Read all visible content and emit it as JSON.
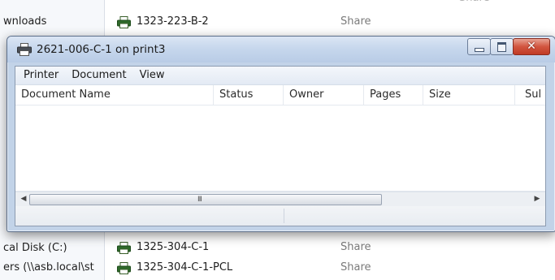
{
  "background_explorer": {
    "sidebar_items": [
      {
        "label": "wnloads"
      },
      {
        "label": "cal Disk (C:)"
      },
      {
        "label": "ers (\\\\asb.local\\st"
      }
    ],
    "printers": [
      {
        "name": "1323-223-B-2",
        "share": "Share"
      },
      {
        "name": "1325-304-C-1",
        "share": "Share"
      },
      {
        "name": "1325-304-C-1-PCL",
        "share": "Share"
      }
    ],
    "top_partial_share": "Share"
  },
  "dialog": {
    "title": "2621-006-C-1 on print3",
    "menu": [
      "Printer",
      "Document",
      "View"
    ],
    "columns": [
      "Document Name",
      "Status",
      "Owner",
      "Pages",
      "Size",
      "Sul"
    ],
    "rows": [],
    "scrollbar_grip": "III"
  },
  "colors": {
    "title_gradient_top": "#dbe6f4",
    "close_button": "#c03b25",
    "window_frame": "#c2d3e8"
  }
}
